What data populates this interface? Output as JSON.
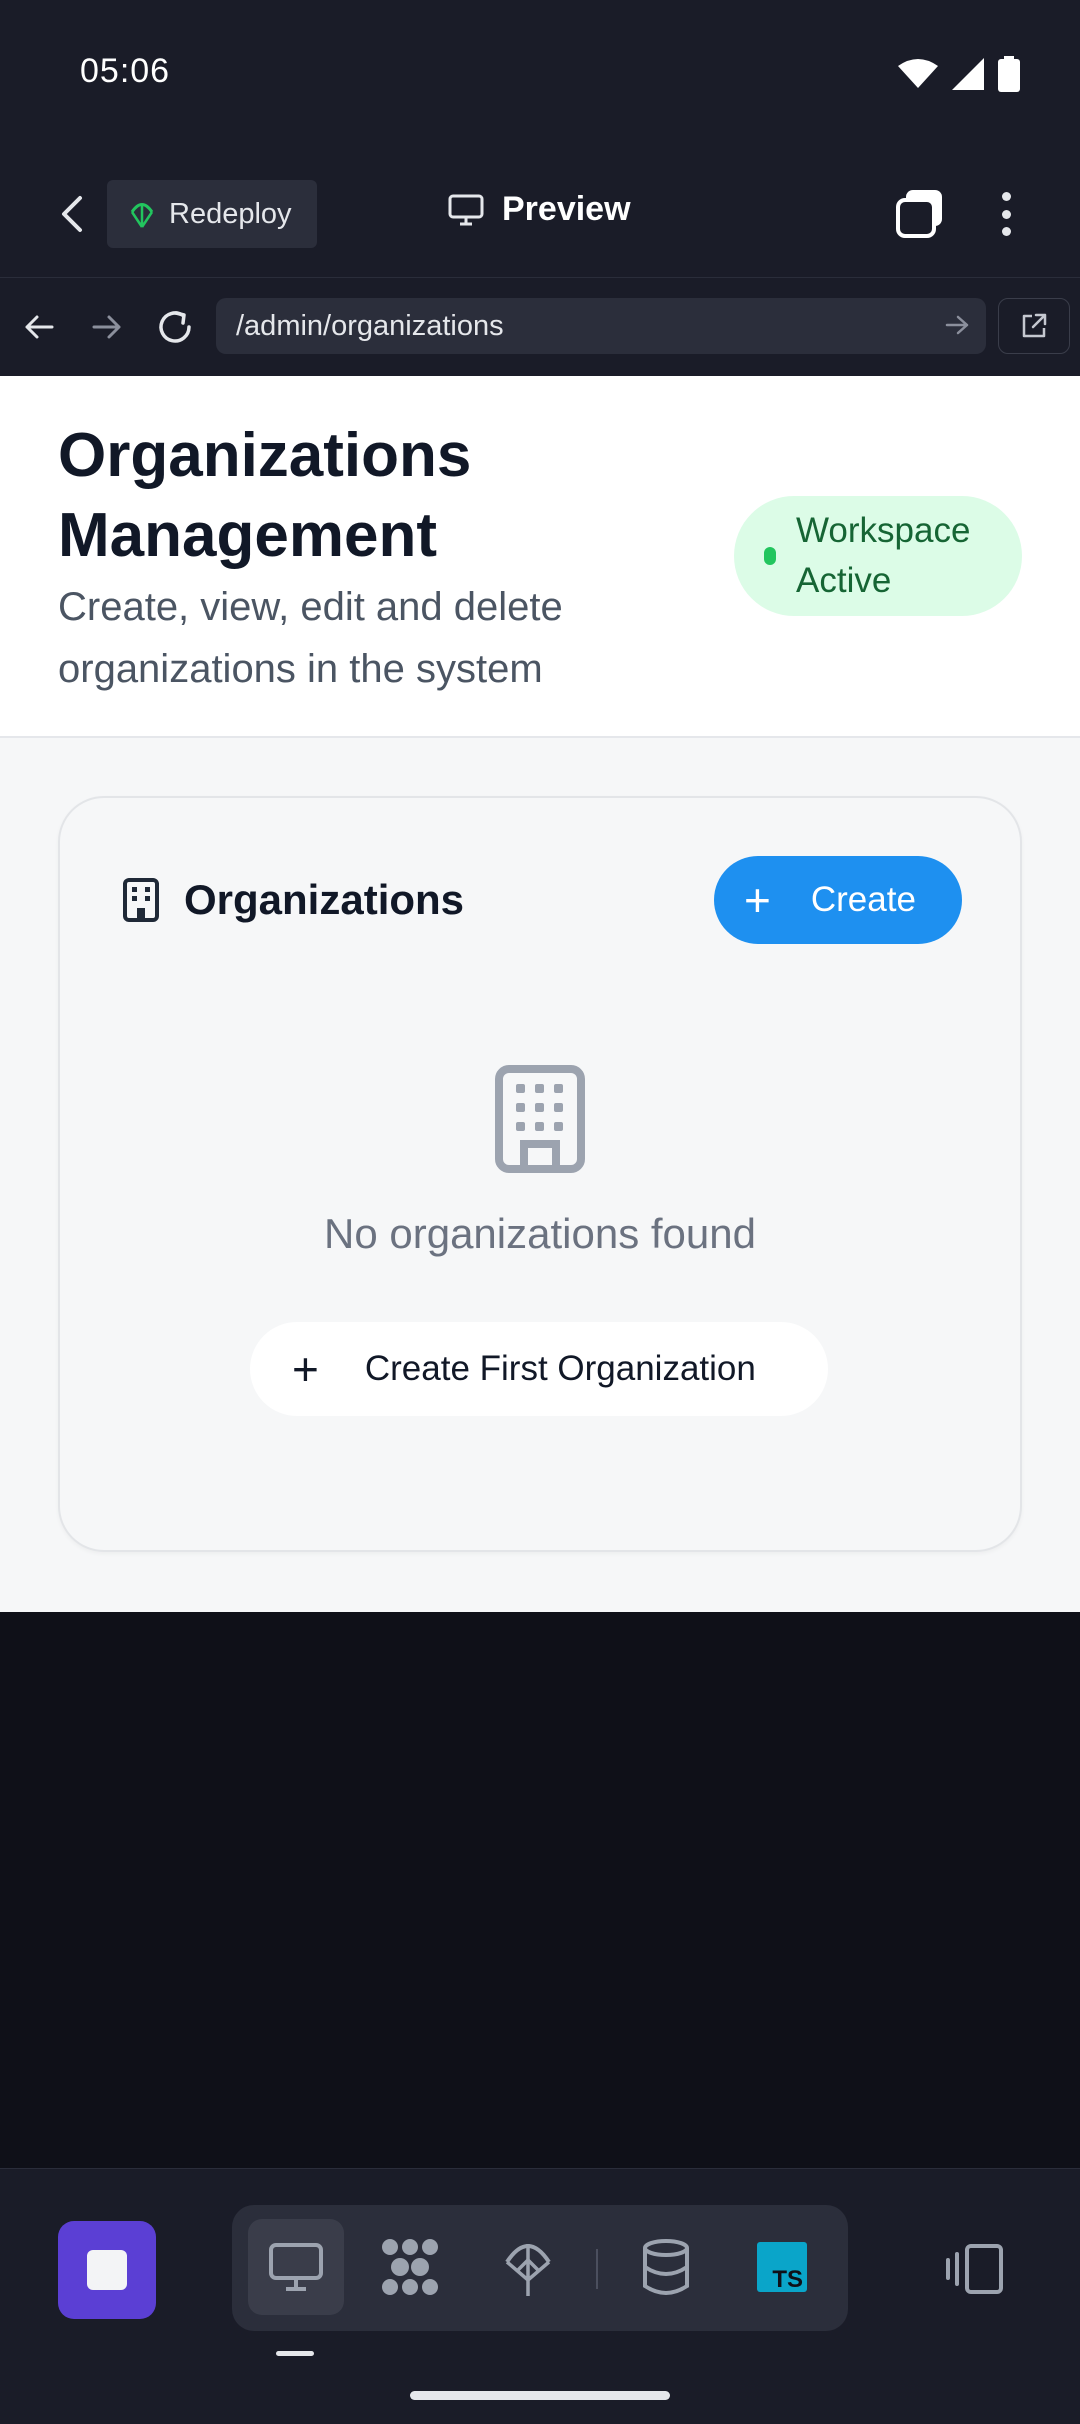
{
  "status_bar": {
    "time": "05:06"
  },
  "top_bar": {
    "redeploy_label": "Redeploy",
    "preview_label": "Preview"
  },
  "url_bar": {
    "url": "/admin/organizations"
  },
  "page": {
    "title": "Organizations Management",
    "subtitle": "Create, view, edit and delete organizations in the system",
    "workspace_badge": "Workspace Active"
  },
  "card": {
    "title": "Organizations",
    "create_label": "Create",
    "empty_message": "No organizations found",
    "create_first_label": "Create First Organization"
  },
  "bottom_toolbar": {
    "items": [
      "app-icon",
      "monitor-icon",
      "nodes-icon",
      "deploy-icon",
      "database-icon",
      "typescript-icon",
      "device-toggle-icon"
    ],
    "ts_text": "TS"
  },
  "colors": {
    "accent_blue": "#1e90f0",
    "badge_green_bg": "#dcfce7",
    "badge_green_text": "#166534",
    "app_purple": "#5b3fd4"
  }
}
